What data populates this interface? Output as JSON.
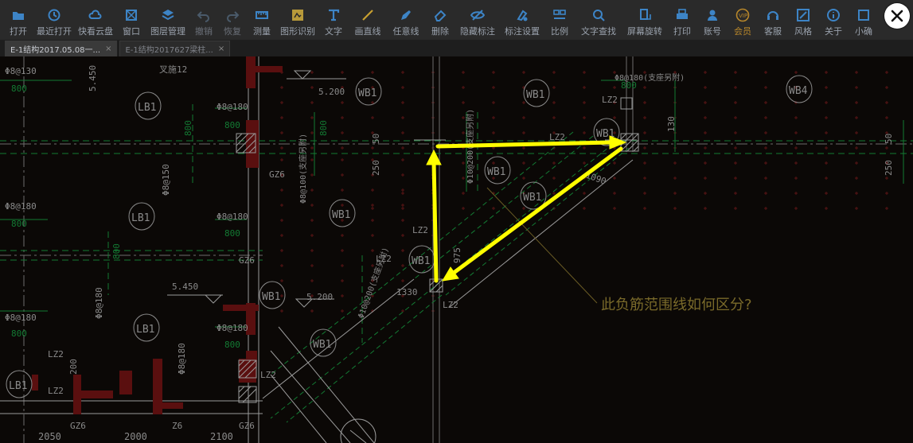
{
  "toolbar": {
    "items": [
      {
        "label": "打开",
        "icon": "folder-open-icon"
      },
      {
        "label": "最近打开",
        "icon": "clock-icon"
      },
      {
        "label": "快看云盘",
        "icon": "cloud-icon"
      },
      {
        "label": "窗口",
        "icon": "window-icon"
      },
      {
        "label": "图层管理",
        "icon": "layers-icon"
      },
      {
        "label": "撤销",
        "icon": "undo-icon"
      },
      {
        "label": "恢复",
        "icon": "redo-icon"
      },
      {
        "label": "测量",
        "icon": "measure-icon"
      },
      {
        "label": "图形识别",
        "icon": "shape-recognize-icon"
      },
      {
        "label": "文字",
        "icon": "text-icon"
      },
      {
        "label": "画直线",
        "icon": "line-icon"
      },
      {
        "label": "任意线",
        "icon": "pencil-icon"
      },
      {
        "label": "删除",
        "icon": "eraser-icon"
      },
      {
        "label": "隐藏标注",
        "icon": "eye-hide-icon"
      },
      {
        "label": "标注设置",
        "icon": "annotation-settings-icon"
      },
      {
        "label": "比例",
        "icon": "scale-icon"
      },
      {
        "label": "文字查找",
        "icon": "text-search-icon"
      },
      {
        "label": "屏幕旋转",
        "icon": "rotate-screen-icon"
      },
      {
        "label": "打印",
        "icon": "printer-icon"
      },
      {
        "label": "账号",
        "icon": "user-icon"
      },
      {
        "label": "会员",
        "icon": "vip-icon"
      },
      {
        "label": "客服",
        "icon": "headset-icon"
      },
      {
        "label": "风格",
        "icon": "style-icon"
      },
      {
        "label": "关于",
        "icon": "info-icon"
      },
      {
        "label": "小确",
        "icon": "mini-icon"
      }
    ]
  },
  "tabs": [
    {
      "label": "E-1结构2017.05.08一...",
      "close": "×"
    },
    {
      "label": "E-1结构2017627梁柱...",
      "close": "×"
    }
  ],
  "drawing": {
    "question": "此负筋范围线如何区分?",
    "labels": {
      "lb": "LB1",
      "wb1": "WB1",
      "wb4": "WB4",
      "lz2": "LZ2",
      "gz6": "GZ6",
      "gz6b": "Z6",
      "rebar130": "Φ8@130",
      "rebar180": "Φ8@180",
      "rebar150": "Φ8@150",
      "rebar180v": "Φ8@180",
      "rebar200": "Φ10@200(支座另附)",
      "rebarTop": "Φ8@180(支座另附)",
      "rebarV": "Φ8@100(支座另附)",
      "dim800": "800",
      "dim130": "130",
      "dim250": "250",
      "dim50": "50",
      "dim975": "975",
      "dim1330": "1330",
      "dim1090": "1090",
      "dim200": "200",
      "dim2050": "2050",
      "dim2000": "2000",
      "dim2100": "2100",
      "elev5450": "5.450",
      "elev5200": "5.200",
      "crossed": "叉施12"
    }
  },
  "colors": {
    "toolbar_bg": "#2a2a2a",
    "canvas_bg": "#0b0806",
    "cad_white": "#8a8a8a",
    "cad_green": "#0f6b2a",
    "cad_red": "#5a0f0f",
    "arrow_yellow": "#ffff00",
    "question_text": "#7a6a2a"
  }
}
